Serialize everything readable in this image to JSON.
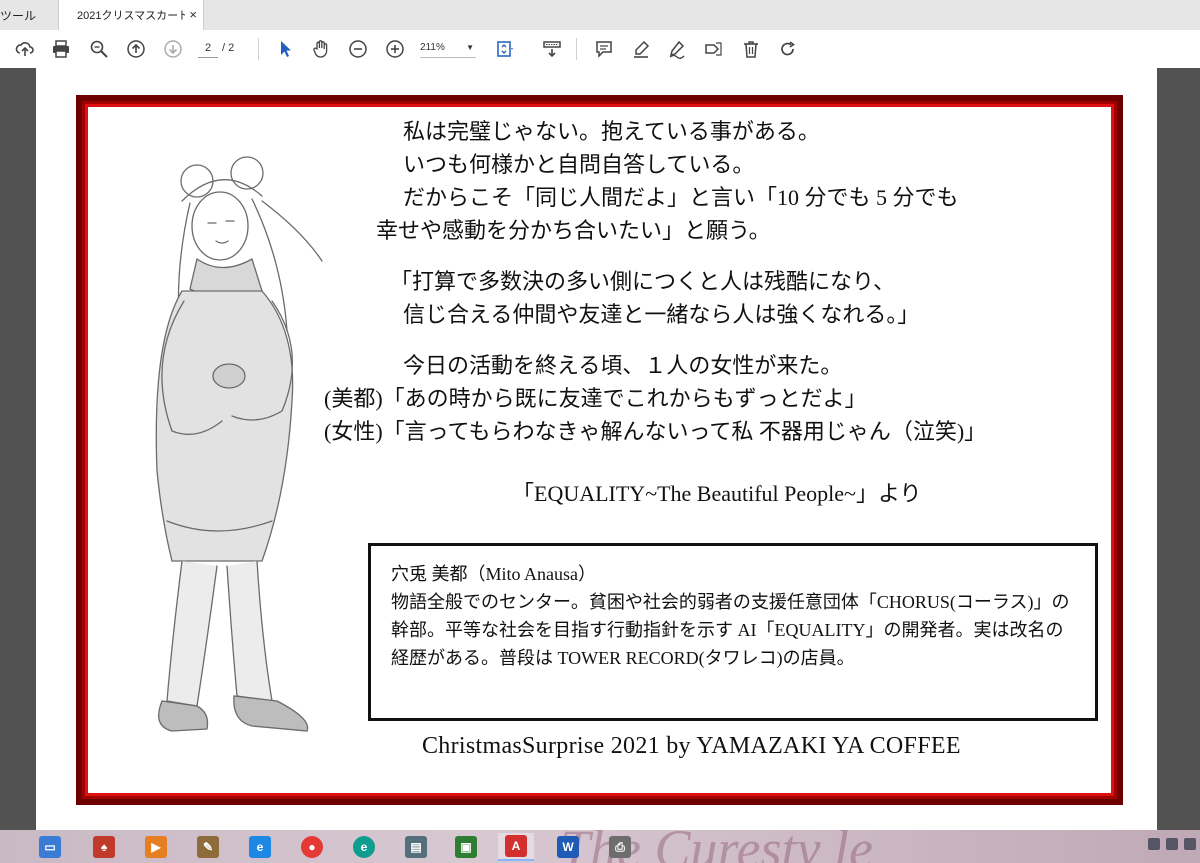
{
  "tabs": {
    "tools_label": "ツール",
    "document_title": "2021クリスマスカード...",
    "close_glyph": "×"
  },
  "toolbar": {
    "current_page": "2",
    "total_pages": "/ 2",
    "zoom": "211%",
    "icons": [
      "upload-icon",
      "print-icon",
      "zoom-search-icon",
      "page-up-icon",
      "page-down-icon",
      "select-cursor-icon",
      "hand-icon",
      "zoom-out-icon",
      "zoom-in-icon",
      "fit-page-icon",
      "scan-icon",
      "comment-icon",
      "highlight-icon",
      "sign-icon",
      "edit-pdf-icon",
      "delete-icon",
      "rotate-icon"
    ]
  },
  "card": {
    "lines": [
      "私は完璧じゃない。抱えている事がある。",
      "いつも何様かと自問自答している。",
      "だからこそ「同じ人間だよ」と言い「10 分でも 5 分でも",
      "幸せや感動を分かち合いたい」と願う。",
      "「打算で多数決の多い側につくと人は残酷になり、",
      "信じ合える仲間や友達と一緒なら人は強くなれる。」",
      "今日の活動を終える頃、１人の女性が来た。",
      "(美都)「あの時から既に友達でこれからもずっとだよ」",
      "(女性)「言ってもらわなきゃ解んないって私  不器用じゃん（泣笑)」",
      "「EQUALITY~The Beautiful People~」より"
    ],
    "profile": {
      "name_line": "穴兎  美都（Mito Anausa）",
      "body": "物語全般でのセンター。貧困や社会的弱者の支援任意団体「CHORUS(コーラス)」の幹部。平等な社会を目指す行動指針を示す AI「EQUALITY」の開発者。実は改名の経歴がある。普段は TOWER RECORD(タワレコ)の店員。"
    },
    "footer": "ChristmasSurprise 2021 by YAMAZAKI YA COFFEE",
    "colors": {
      "frame_dark": "#6e0000",
      "frame_red": "#e01010"
    }
  },
  "taskbar": {
    "apps": [
      "desktop-app-icon",
      "cards-game-icon",
      "media-player-icon",
      "paint-icon",
      "internet-explorer-icon",
      "chrome-icon",
      "edge-icon",
      "scanner-app-icon",
      "remote-app-icon",
      "acrobat-icon",
      "word-icon",
      "printer-app-icon"
    ],
    "wallpaper_text": "The Curesty le"
  }
}
